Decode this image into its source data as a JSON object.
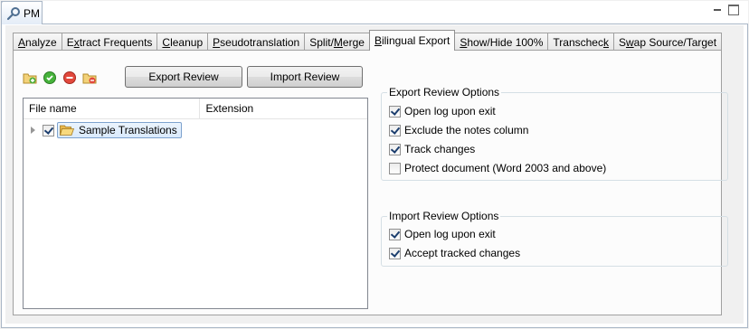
{
  "view": {
    "title": "PM"
  },
  "tabs": [
    {
      "label": "Analyze",
      "u": "A",
      "rest": "nalyze"
    },
    {
      "label": "Extract Frequents",
      "pre": "E",
      "u": "x",
      "rest": "tract Frequents"
    },
    {
      "label": "Cleanup",
      "u": "C",
      "rest": "leanup"
    },
    {
      "label": "Pseudotranslation",
      "u": "P",
      "rest": "seudotranslation"
    },
    {
      "label": "Split/Merge",
      "pre": "Split/",
      "u": "M",
      "rest": "erge"
    },
    {
      "label": "Bilingual Export",
      "u": "B",
      "rest": "ilingual Export"
    },
    {
      "label": "Show/Hide 100%",
      "u": "S",
      "rest": "how/Hide 100%"
    },
    {
      "label": "Transcheck",
      "pre": "Transchec",
      "u": "k",
      "rest": ""
    },
    {
      "label": "Swap Source/Target",
      "pre": "S",
      "u": "w",
      "rest": "ap Source/Target"
    }
  ],
  "toolbar": {
    "icons": [
      "add-folder-icon",
      "check-icon",
      "remove-icon",
      "folder-remove-icon"
    ],
    "export_review": "Export Review",
    "import_review": "Import Review"
  },
  "tree": {
    "columns": [
      "File name",
      "Extension"
    ],
    "rows": [
      {
        "name": "Sample Translations",
        "checked": true
      }
    ]
  },
  "export_options": {
    "title": "Export Review Options",
    "items": [
      {
        "label": "Open log upon exit",
        "checked": true
      },
      {
        "label": "Exclude the notes column",
        "checked": true
      },
      {
        "label": "Track changes",
        "checked": true
      },
      {
        "label": "Protect document (Word 2003 and above)",
        "checked": false
      }
    ]
  },
  "import_options": {
    "title": "Import Review Options",
    "items": [
      {
        "label": "Open log upon exit",
        "checked": true
      },
      {
        "label": "Accept tracked changes",
        "checked": true
      }
    ]
  },
  "colors": {
    "accent": "#7da2ce",
    "check": "#1c3e6e"
  }
}
